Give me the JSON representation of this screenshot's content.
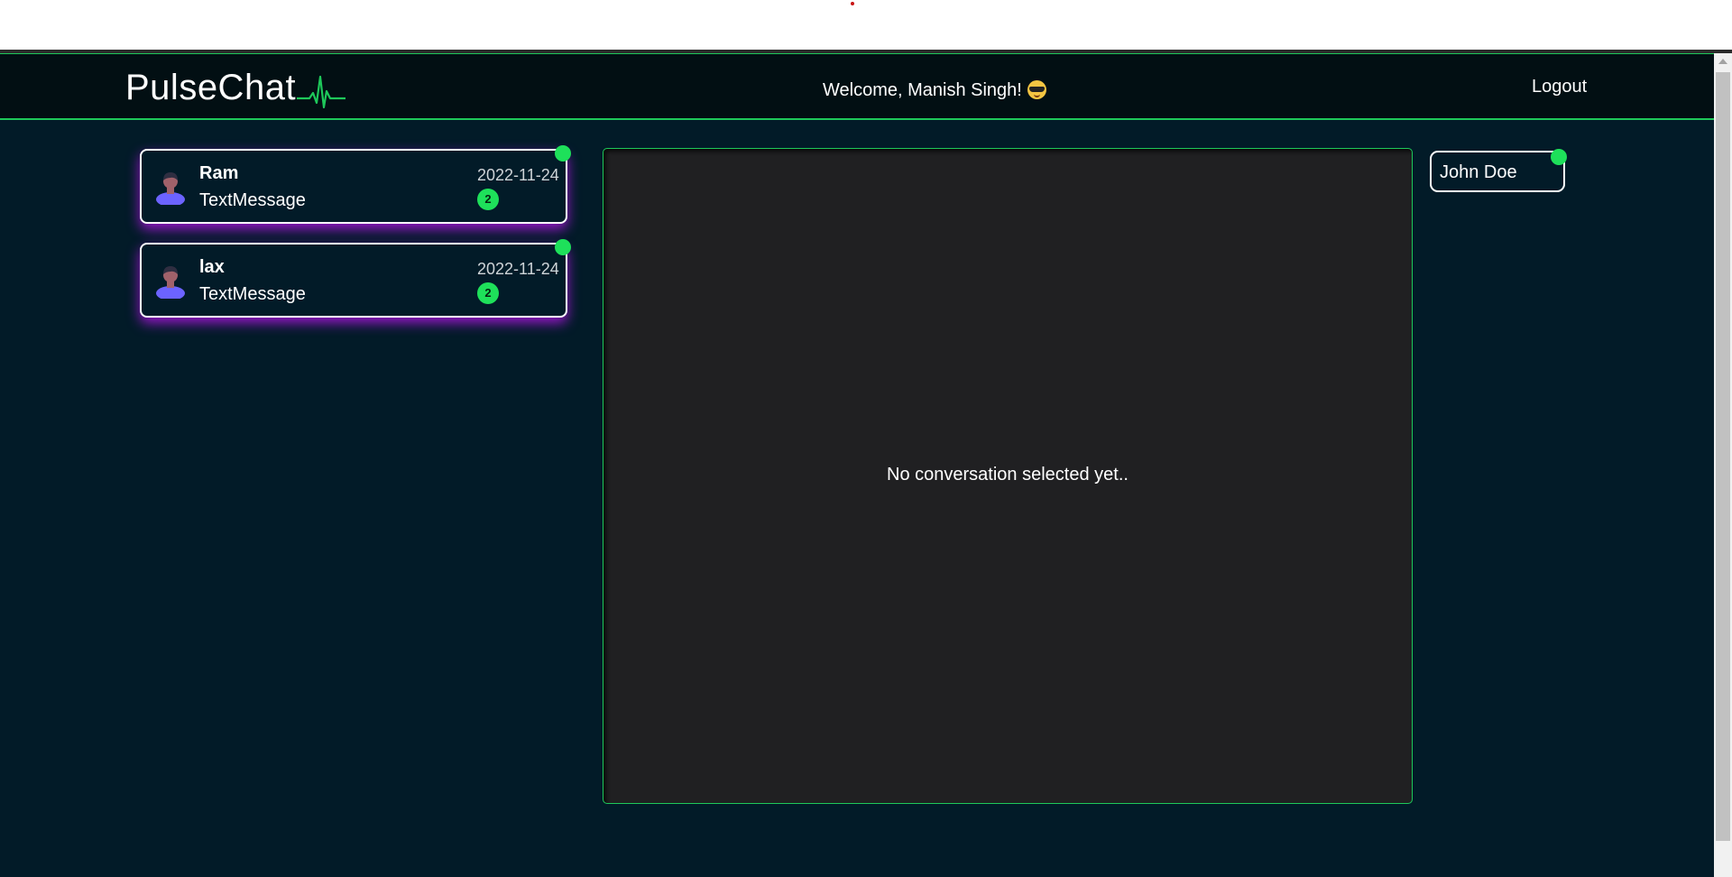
{
  "header": {
    "brand": "PulseChat",
    "welcome": "Welcome, Manish Singh!",
    "logout_label": "Logout"
  },
  "conversations": [
    {
      "name": "Ram",
      "message": "TextMessage",
      "date": "2022-11-24",
      "unread": "2",
      "online": true
    },
    {
      "name": "lax",
      "message": "TextMessage",
      "date": "2022-11-24",
      "unread": "2",
      "online": true
    }
  ],
  "chat": {
    "empty_text": "No conversation selected yet.."
  },
  "online_users": [
    {
      "name": "John Doe",
      "online": true
    }
  ],
  "colors": {
    "accent": "#1ee05a",
    "background": "#021b28",
    "navbar": "#020f13",
    "card_glow": "#c814ff",
    "chat_panel": "#202022"
  },
  "icons": [
    "pulse-icon",
    "avatar-icon",
    "sunglasses-emoji"
  ]
}
